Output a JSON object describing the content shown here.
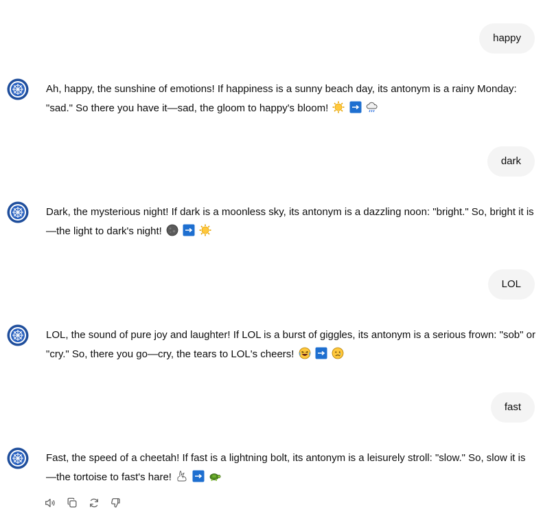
{
  "conversation": [
    {
      "user": "happy",
      "reply": "Ah, happy, the sunshine of emotions! If happiness is a sunny beach day, its antonym is a rainy Monday: \"sad.\" So there you have it—sad, the gloom to happy's bloom!",
      "emojis": [
        "sun-icon",
        "arrow-right-icon",
        "rain-cloud-icon"
      ]
    },
    {
      "user": "dark",
      "reply": "Dark, the mysterious night! If dark is a moonless sky, its antonym is a dazzling noon: \"bright.\" So, bright it is—the light to dark's night!",
      "emojis": [
        "new-moon-icon",
        "arrow-right-icon",
        "sun-icon"
      ]
    },
    {
      "user": "LOL",
      "reply": "LOL, the sound of pure joy and laughter! If LOL is a burst of giggles, its antonym is a serious frown: \"sob\" or \"cry.\" So, there you go—cry, the tears to LOL's cheers!",
      "emojis": [
        "laughing-face-icon",
        "arrow-right-icon",
        "sad-face-icon"
      ]
    },
    {
      "user": "fast",
      "reply": "Fast, the speed of a cheetah! If fast is a lightning bolt, its antonym is a leisurely stroll: \"slow.\" So, slow it is—the tortoise to fast's hare!",
      "emojis": [
        "rabbit-icon",
        "arrow-right-icon",
        "turtle-icon"
      ]
    }
  ],
  "actions": [
    "speaker-icon",
    "copy-icon",
    "regenerate-icon",
    "thumbs-down-icon"
  ],
  "colors": {
    "user_bubble": "#f4f4f4",
    "avatar_ring": "#1f4e9c",
    "arrow_button": "#1e6fd0"
  }
}
